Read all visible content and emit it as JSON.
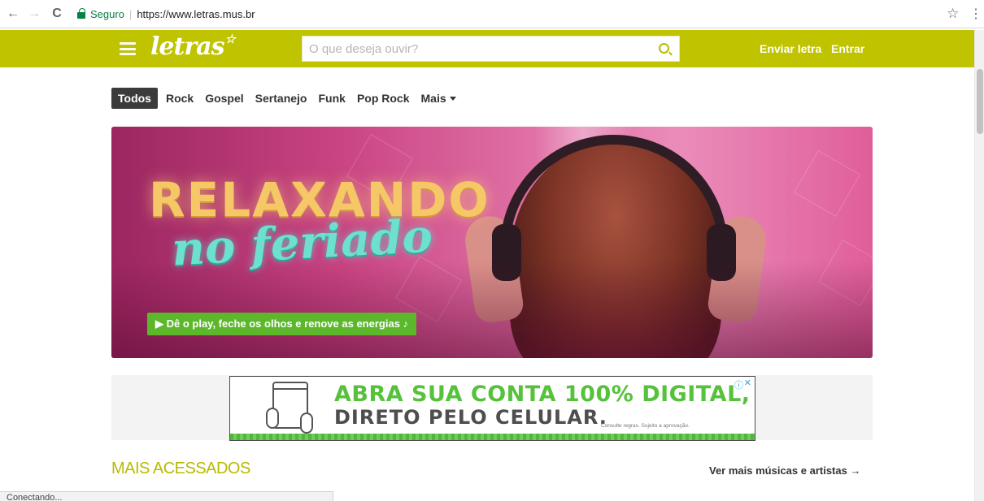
{
  "browser": {
    "secure_label": "Seguro",
    "separator": "|",
    "url": "https://www.letras.mus.br",
    "back_glyph": "←",
    "forward_glyph": "→",
    "reload_glyph": "C",
    "bookmark_glyph": "☆",
    "menu_glyph": "⋮"
  },
  "header": {
    "logo": "letras",
    "logo_star": "☆",
    "search_placeholder": "O que deseja ouvir?",
    "links": [
      "Enviar letra",
      "Entrar"
    ],
    "bar_color": "#bfc300"
  },
  "tabs": [
    {
      "label": "Todos",
      "active": true
    },
    {
      "label": "Rock",
      "active": false
    },
    {
      "label": "Gospel",
      "active": false
    },
    {
      "label": "Sertanejo",
      "active": false
    },
    {
      "label": "Funk",
      "active": false
    },
    {
      "label": "Pop Rock",
      "active": false
    },
    {
      "label": "Mais",
      "active": false
    }
  ],
  "hero": {
    "title": "RELAXANDO",
    "subtitle": "no feriado",
    "cta": "▶  Dê o play, feche os olhos e renove as energias ♪"
  },
  "ad": {
    "line1": "ABRA SUA CONTA 100% DIGITAL,",
    "line2": "DIRETO PELO CELULAR.",
    "fine_print": "Consulte regras. Sujeito a aprovação.",
    "info_glyph": "ⓘ",
    "close_glyph": "✕"
  },
  "section": {
    "title": "MAIS ACESSADOS",
    "see_more": "Ver mais músicas e artistas →"
  },
  "status_bar": "Conectando..."
}
